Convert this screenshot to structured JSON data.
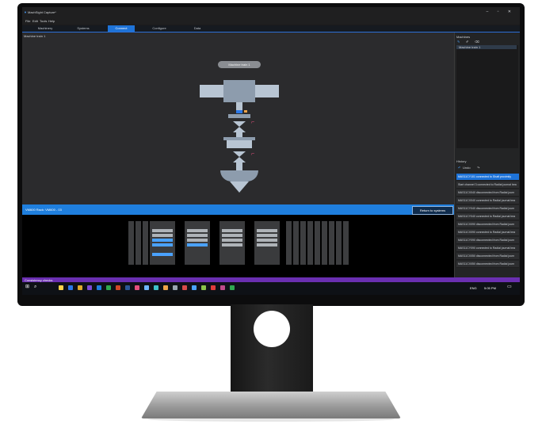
{
  "app": {
    "title": "MachSight Capture*",
    "window_controls": "– ▫ ✕",
    "menu": [
      "File",
      "Edit",
      "Tools",
      "Help"
    ],
    "tabs": [
      "Machinery",
      "Systems",
      "Connect",
      "Configure",
      "Data"
    ],
    "active_tab": "Connect"
  },
  "canvas": {
    "label": "Machine train 1",
    "machine_label": "Machine train 1"
  },
  "module_bar": {
    "text": "VM600 Rack: VM600 - 03",
    "return_button": "Return to systems"
  },
  "right_panel": {
    "machines_title": "Machines",
    "machine_item": "Machine train 1",
    "history_title": "History",
    "history_undo": "Undo",
    "history": [
      "MAS11CY101 connected to Shaft proximity",
      "Start channel 3 connected to Radial journal bea",
      "MAS11CX040 disconnected from Radial journ",
      "MAS11CX040 connected to Radial journal bea",
      "MAS11CY040 disconnected from Radial journ",
      "MAS11CY040 connected to Radial journal bea",
      "MAS11CX090 disconnected from Radial journ",
      "MAS11CX090 connected to Radial journal bea",
      "MAS11CY090 disconnected from Radial journ",
      "MAS11CY090 connected to Radial journal bea",
      "MAS11CX050 disconnected from Radial journ",
      "MAS11CX050 disconnected from Radial journ"
    ]
  },
  "status": {
    "text": "Consistency checks"
  },
  "taskbar": {
    "clock": "5:05 PM",
    "lang": "ENG"
  },
  "colors": {
    "accent": "#1e73d8",
    "status_bar": "#6a2fb1",
    "marker": "#e54f7d"
  }
}
